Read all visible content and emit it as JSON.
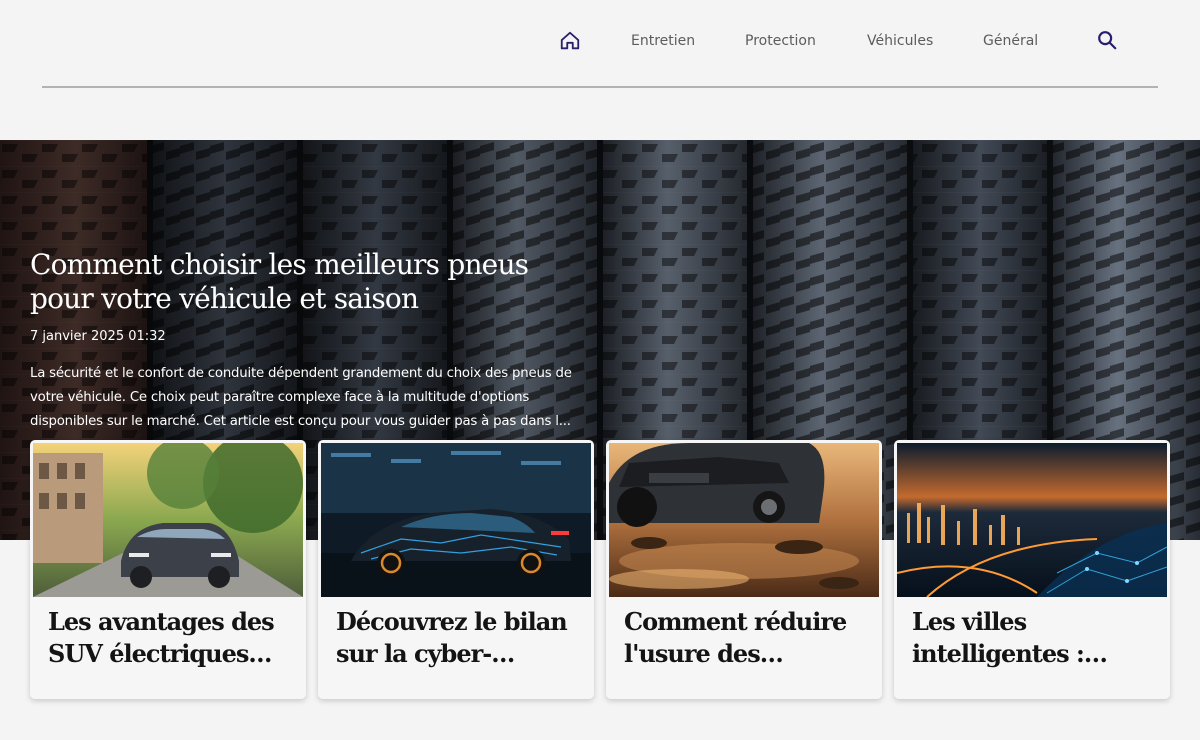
{
  "nav": {
    "home_icon": "home-icon",
    "links": [
      "Entretien",
      "Protection",
      "Véhicules",
      "Général"
    ],
    "search_icon": "search-icon",
    "accent": "#2a1f6b"
  },
  "hero": {
    "title": "Comment choisir les meilleurs pneus pour votre véhicule et saison",
    "date": "7 janvier 2025 01:32",
    "excerpt": "La sécurité et le confort de conduite dépendent grandement du choix des pneus de votre véhicule. Ce choix peut paraître complexe face à la multitude d'options disponibles sur le marché. Cet article est conçu pour vous guider pas à pas dans l..."
  },
  "cards": [
    {
      "title": "Les avantages des SUV électriques fa..."
    },
    {
      "title": "Découvrez le bilan sur la cyber-sécurit..."
    },
    {
      "title": "Comment réduire l'usure des pneus..."
    },
    {
      "title": "Les villes intelligentes : une..."
    }
  ]
}
